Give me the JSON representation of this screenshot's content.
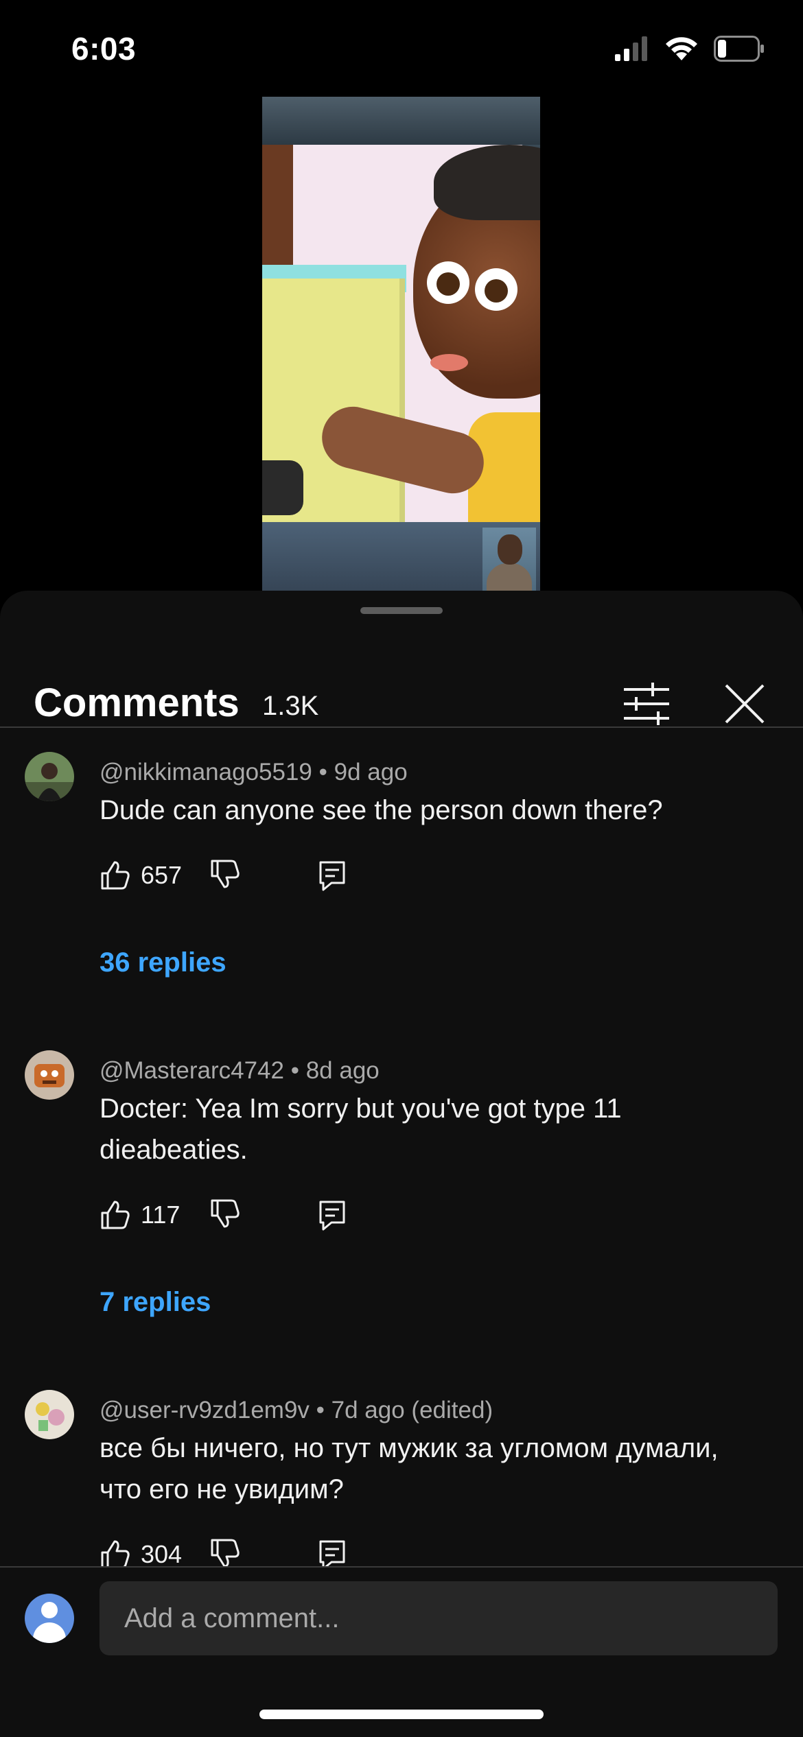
{
  "status_bar": {
    "time": "6:03",
    "icons": [
      "cellular-signal-icon",
      "wifi-icon",
      "battery-icon"
    ],
    "battery_level": 0.2
  },
  "video": {
    "description_icons": [
      "video-thumbnail"
    ]
  },
  "comments_panel": {
    "title": "Comments",
    "count": "1.3K",
    "filter_icon": "sliders-icon",
    "close_icon": "close-icon",
    "comments": [
      {
        "author": "@nikkimanago5519",
        "age": "9d ago",
        "text": "Dude can anyone see the person down there?",
        "likes": "657",
        "replies": "36 replies"
      },
      {
        "author": "@Masterarc4742",
        "age": "8d ago",
        "text": "Docter: Yea Im sorry but you've got type 11 dieabeaties.",
        "likes": "117",
        "replies": "7 replies"
      },
      {
        "author": "@user-rv9zd1em9v",
        "age": "7d ago (edited)",
        "text": "все бы ничего, но тут мужик за угломом думали, что его не увидим?",
        "likes": "304"
      }
    ],
    "separator": "•"
  },
  "composer": {
    "placeholder": "Add a comment..."
  },
  "colors": {
    "background": "#0f0f0f",
    "link": "#3ea6ff",
    "secondary_text": "#aaaaaa"
  }
}
